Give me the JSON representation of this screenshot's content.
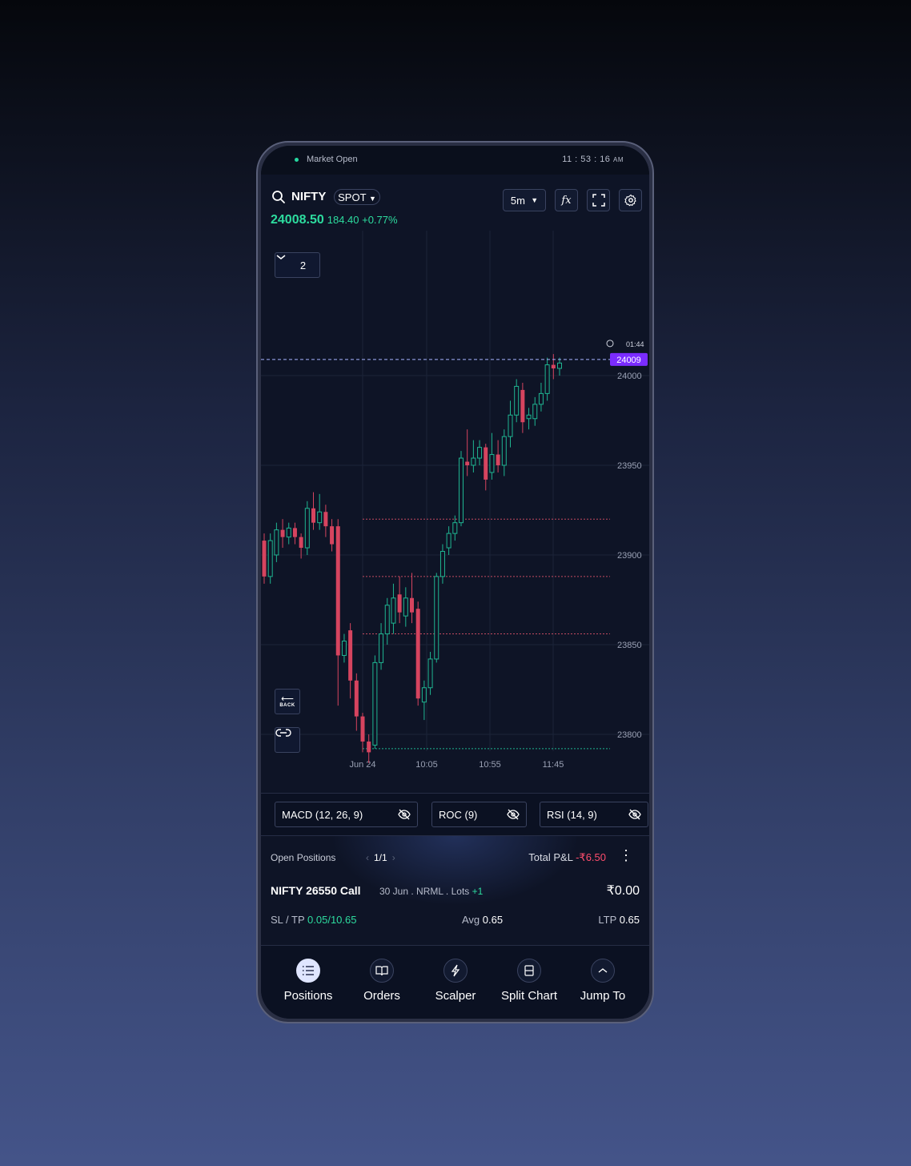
{
  "status": {
    "market": "Market Open",
    "time": "11 : 53 : 16",
    "ampm": "AM"
  },
  "header": {
    "symbol": "NIFTY",
    "segment": "SPOT",
    "price": "24008.50",
    "change": "184.40 +0.77%",
    "interval": "5m",
    "fx_label": "fx"
  },
  "chart": {
    "layers_count": "2",
    "timer": "01:44",
    "last_price_tag": "24009",
    "back_label": "BACK",
    "y_ticks": [
      "24000",
      "23950",
      "23900",
      "23850",
      "23800"
    ],
    "x_ticks": [
      "Jun 24",
      "10:05",
      "10:55",
      "11:45"
    ]
  },
  "chart_data": {
    "type": "candlestick",
    "x_ticks": [
      "Jun 24",
      "10:05",
      "10:55",
      "11:45"
    ],
    "y_ticks": [
      24000,
      23950,
      23900,
      23850,
      23800
    ],
    "ylim": [
      23760,
      24020
    ],
    "last_price": 24009,
    "candles": [
      [
        23908,
        23888,
        23912,
        23884
      ],
      [
        23888,
        23908,
        23912,
        23884
      ],
      [
        23900,
        23914,
        23918,
        23896
      ],
      [
        23914,
        23910,
        23920,
        23904
      ],
      [
        23910,
        23915,
        23918,
        23906
      ],
      [
        23915,
        23910,
        23918,
        23906
      ],
      [
        23910,
        23904,
        23912,
        23898
      ],
      [
        23904,
        23926,
        23930,
        23900
      ],
      [
        23926,
        23918,
        23935,
        23914
      ],
      [
        23918,
        23924,
        23934,
        23914
      ],
      [
        23924,
        23916,
        23928,
        23910
      ],
      [
        23916,
        23906,
        23920,
        23902
      ],
      [
        23916,
        23844,
        23920,
        23816
      ],
      [
        23844,
        23852,
        23856,
        23840
      ],
      [
        23858,
        23830,
        23862,
        23820
      ],
      [
        23830,
        23810,
        23834,
        23802
      ],
      [
        23810,
        23796,
        23812,
        23790
      ],
      [
        23796,
        23790,
        23800,
        23784
      ],
      [
        23794,
        23840,
        23844,
        23792
      ],
      [
        23840,
        23856,
        23862,
        23836
      ],
      [
        23856,
        23872,
        23876,
        23850
      ],
      [
        23862,
        23876,
        23884,
        23856
      ],
      [
        23878,
        23868,
        23888,
        23862
      ],
      [
        23866,
        23876,
        23882,
        23860
      ],
      [
        23876,
        23868,
        23890,
        23862
      ],
      [
        23870,
        23820,
        23874,
        23816
      ],
      [
        23818,
        23826,
        23830,
        23808
      ],
      [
        23826,
        23842,
        23846,
        23822
      ],
      [
        23842,
        23888,
        23890,
        23840
      ],
      [
        23888,
        23902,
        23906,
        23884
      ],
      [
        23904,
        23912,
        23916,
        23900
      ],
      [
        23912,
        23918,
        23922,
        23908
      ],
      [
        23918,
        23954,
        23958,
        23916
      ],
      [
        23952,
        23950,
        23970,
        23944
      ],
      [
        23950,
        23954,
        23964,
        23946
      ],
      [
        23954,
        23960,
        23964,
        23950
      ],
      [
        23960,
        23942,
        23962,
        23936
      ],
      [
        23946,
        23956,
        23968,
        23942
      ],
      [
        23956,
        23950,
        23964,
        23946
      ],
      [
        23950,
        23966,
        23970,
        23944
      ],
      [
        23966,
        23978,
        23986,
        23960
      ],
      [
        23978,
        23994,
        23998,
        23974
      ],
      [
        23992,
        23974,
        23996,
        23968
      ],
      [
        23976,
        23978,
        23982,
        23970
      ],
      [
        23976,
        23984,
        23988,
        23972
      ],
      [
        23984,
        23990,
        23996,
        23980
      ],
      [
        23990,
        24006,
        24010,
        23986
      ],
      [
        24006,
        24004,
        24012,
        23998
      ],
      [
        24004,
        24007,
        24010,
        24000
      ]
    ],
    "level_lines": [
      {
        "value": 23920,
        "color": "#c24a60"
      },
      {
        "value": 23888,
        "color": "#c24a60"
      },
      {
        "value": 23856,
        "color": "#c24a60"
      },
      {
        "value": 23792,
        "color": "#1fb591"
      },
      {
        "value": 23760,
        "color": "#1fb591"
      }
    ]
  },
  "indicators": [
    {
      "label": "MACD (12, 26, 9)"
    },
    {
      "label": "ROC (9)"
    },
    {
      "label": "RSI (14, 9)"
    }
  ],
  "positions": {
    "title": "Open Positions",
    "page": "1/1",
    "total_label": "Total P&L",
    "total_value": "-₹6.50",
    "name": "NIFTY 26550 Call",
    "meta": "30 Jun . NRML . Lots",
    "lots": "+1",
    "amount": "₹0.00",
    "sltp_label": "SL / TP",
    "sltp_value": "0.05/10.65",
    "avg_label": "Avg",
    "avg_value": "0.65",
    "ltp_label": "LTP",
    "ltp_value": "0.65"
  },
  "nav": [
    {
      "label": "Positions"
    },
    {
      "label": "Orders"
    },
    {
      "label": "Scalper"
    },
    {
      "label": "Split Chart"
    },
    {
      "label": "Jump To"
    }
  ],
  "colors": {
    "up": "#1fb591",
    "down": "#d6445f",
    "accent": "#7b2cff",
    "bg": "#0e1426"
  }
}
